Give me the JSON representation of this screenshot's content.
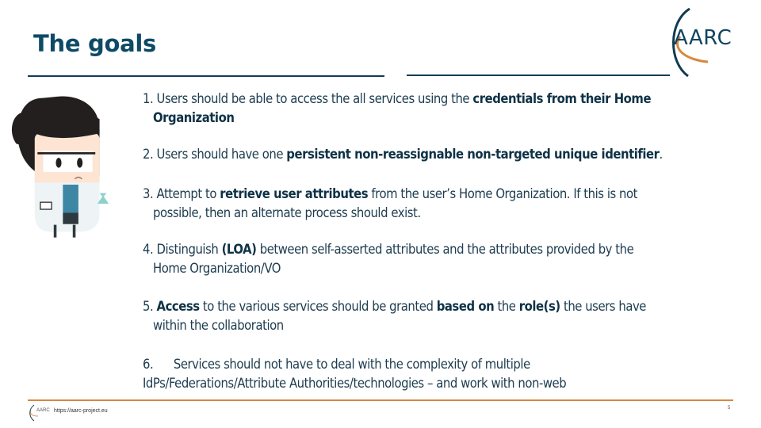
{
  "slide": {
    "title": "The goals",
    "logo_text": "AARC",
    "footer_url": "https://aarc-project.eu",
    "footer_logo_text": "AARC",
    "page_number": "5"
  },
  "goals": [
    {
      "number": "1.",
      "parts": [
        {
          "text": " Users should be able to access the all services using the ",
          "bold": false
        },
        {
          "text": "credentials from their Home",
          "bold": true
        }
      ],
      "cont": [
        {
          "text": "Organization",
          "bold": true
        }
      ]
    },
    {
      "number": "2.",
      "parts": [
        {
          "text": " Users should have one ",
          "bold": false
        },
        {
          "text": "persistent non-reassignable non-targeted unique identifier",
          "bold": true
        },
        {
          "text": ".",
          "bold": false
        }
      ],
      "cont": []
    },
    {
      "number": "3.",
      "parts": [
        {
          "text": " Attempt to ",
          "bold": false
        },
        {
          "text": "retrieve user attributes",
          "bold": true
        },
        {
          "text": " from the user’s Home Organization. If this is not",
          "bold": false
        }
      ],
      "cont": [
        {
          "text": "possible, then an alternate process should exist.",
          "bold": false
        }
      ]
    },
    {
      "number": "4.",
      "parts": [
        {
          "text": " Distinguish ",
          "bold": false
        },
        {
          "text": "(LOA)",
          "bold": true
        },
        {
          "text": " between self-asserted attributes and the attributes provided by the",
          "bold": false
        }
      ],
      "cont": [
        {
          "text": "Home Organization/VO",
          "bold": false
        }
      ]
    },
    {
      "number": "5.",
      "parts": [
        {
          "text": " ",
          "bold": false
        },
        {
          "text": "Access",
          "bold": true
        },
        {
          "text": " to the various services should be granted ",
          "bold": false
        },
        {
          "text": "based on",
          "bold": true
        },
        {
          "text": " the ",
          "bold": false
        },
        {
          "text": "role(s)",
          "bold": true
        },
        {
          "text": " the users have",
          "bold": false
        }
      ],
      "cont": [
        {
          "text": "within the collaboration",
          "bold": false
        }
      ]
    },
    {
      "number": "6.",
      "parts": [
        {
          "text": "      Services should not have to deal with the complexity of multiple",
          "bold": false
        }
      ],
      "cont": [
        {
          "text": "IdPs/Federations/Attribute Authorities/technologies – and work with non-web",
          "bold": false
        }
      ]
    }
  ],
  "colors": {
    "title": "#0e4a66",
    "rule_top": "#123c52",
    "rule_footer": "#d8873e",
    "logo_arc_dark": "#123c52",
    "logo_arc_orange": "#d8873e"
  }
}
